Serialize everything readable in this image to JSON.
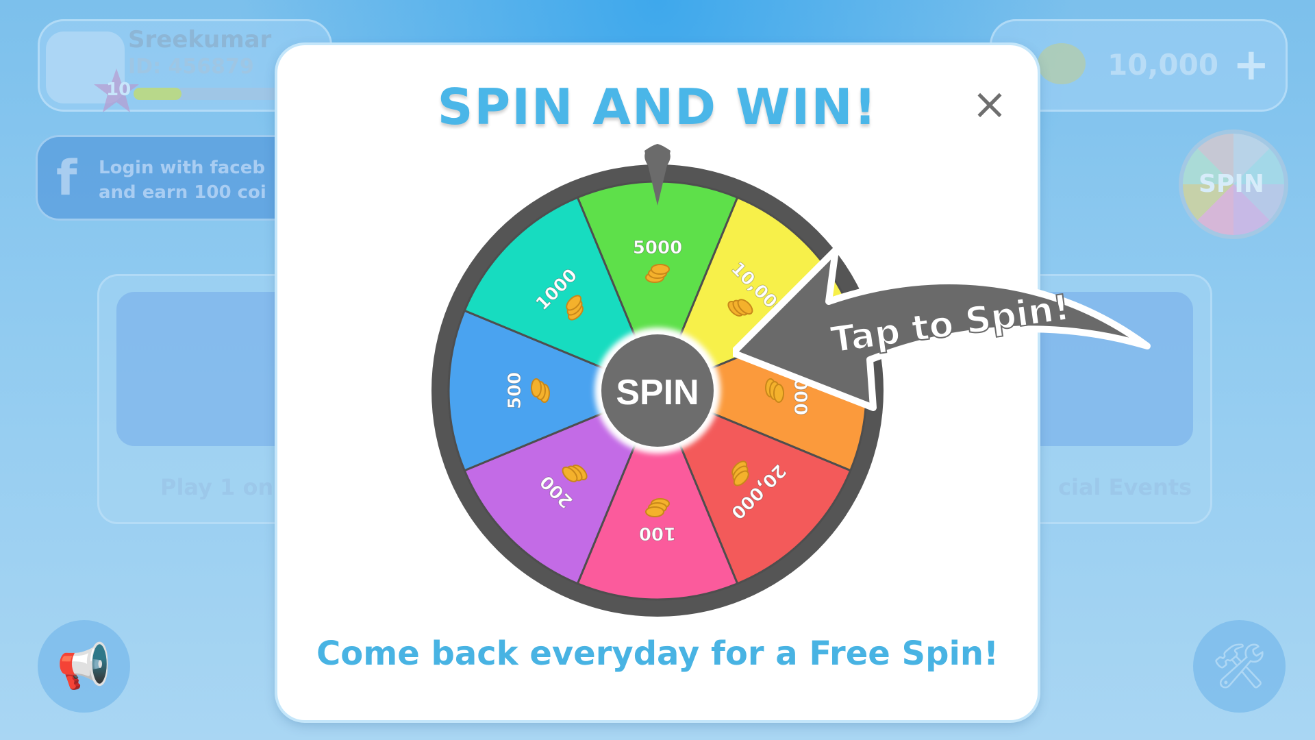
{
  "background": {
    "profile": {
      "name": "Sreekumar",
      "id": "ID: 456879",
      "level": "10",
      "xp_fraction": 0.25
    },
    "facebook": {
      "line1": "Login with faceb",
      "line2": "and earn 100 coi"
    },
    "coins": {
      "value": "10,000",
      "plus": "+"
    },
    "mini_spin_label": "SPIN",
    "left_card_text": "Play 1 on",
    "right_card_text": "cial Events"
  },
  "modal": {
    "title": "SPIN AND WIN!",
    "close_symbol": "×",
    "footer": "Come back everyday for a Free Spin!",
    "callout": "Tap to Spin!"
  },
  "wheel": {
    "center_label": "SPIN",
    "segments": [
      {
        "label": "5000",
        "color": "#5ee04a"
      },
      {
        "label": "10,000",
        "color": "#f7f04a"
      },
      {
        "label": "1000",
        "color": "#fb9a3c"
      },
      {
        "label": "20,000",
        "color": "#f35a5a"
      },
      {
        "label": "100",
        "color": "#fb5b9c"
      },
      {
        "label": "200",
        "color": "#c36be6"
      },
      {
        "label": "500",
        "color": "#4aa3f0"
      },
      {
        "label": "1000",
        "color": "#17dcc0"
      }
    ],
    "rim_color": "#555555",
    "coin_color": "#f4b12c"
  }
}
